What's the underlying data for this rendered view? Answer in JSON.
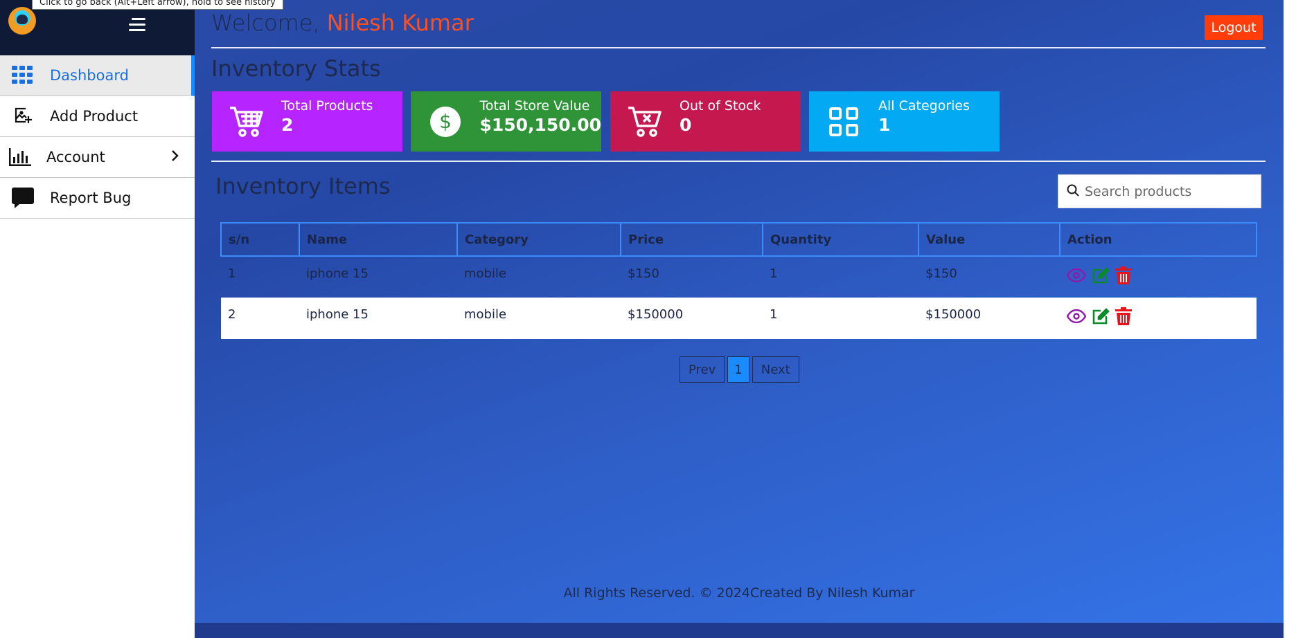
{
  "browser_tooltip": "Click to go back (Alt+Left arrow), hold to see history",
  "sidebar": {
    "items": [
      {
        "label": "Dashboard",
        "icon": "grid-icon"
      },
      {
        "label": "Add Product",
        "icon": "add-image-icon"
      },
      {
        "label": "Account",
        "icon": "bar-chart-icon"
      },
      {
        "label": "Report Bug",
        "icon": "chat-bubble-icon"
      }
    ]
  },
  "header": {
    "welcome": "Welcome,",
    "username": "Nilesh Kumar",
    "logout_label": "Logout"
  },
  "stats": {
    "title": "Inventory Stats",
    "cards": [
      {
        "label": "Total Products",
        "value": "2",
        "color": "#b624ff",
        "icon": "cart-icon"
      },
      {
        "label": "Total Store Value",
        "value": "$150,150.00",
        "color": "#2f9438",
        "icon": "dollar-icon"
      },
      {
        "label": "Out of Stock",
        "value": "0",
        "color": "#c4184f",
        "icon": "cart-x-icon"
      },
      {
        "label": "All Categories",
        "value": "1",
        "color": "#04a9f4",
        "icon": "categories-icon"
      }
    ]
  },
  "inventory": {
    "title": "Inventory Items",
    "search_placeholder": "Search products",
    "columns": [
      "s/n",
      "Name",
      "Category",
      "Price",
      "Quantity",
      "Value",
      "Action"
    ],
    "rows": [
      {
        "sn": "1",
        "name": "iphone 15",
        "category": "mobile",
        "price": "$150",
        "quantity": "1",
        "value": "$150"
      },
      {
        "sn": "2",
        "name": "iphone 15",
        "category": "mobile",
        "price": "$150000",
        "quantity": "1",
        "value": "$150000"
      }
    ]
  },
  "pagination": {
    "prev": "Prev",
    "current": "1",
    "next": "Next"
  },
  "footer": "All Rights Reserved. © 2024Created By Nilesh Kumar",
  "colors": {
    "accent": "#ff4f1f",
    "active_nav": "#1a6fe0",
    "view": "#8e1aa8",
    "edit": "#0a8a28",
    "delete": "#e8141b"
  }
}
